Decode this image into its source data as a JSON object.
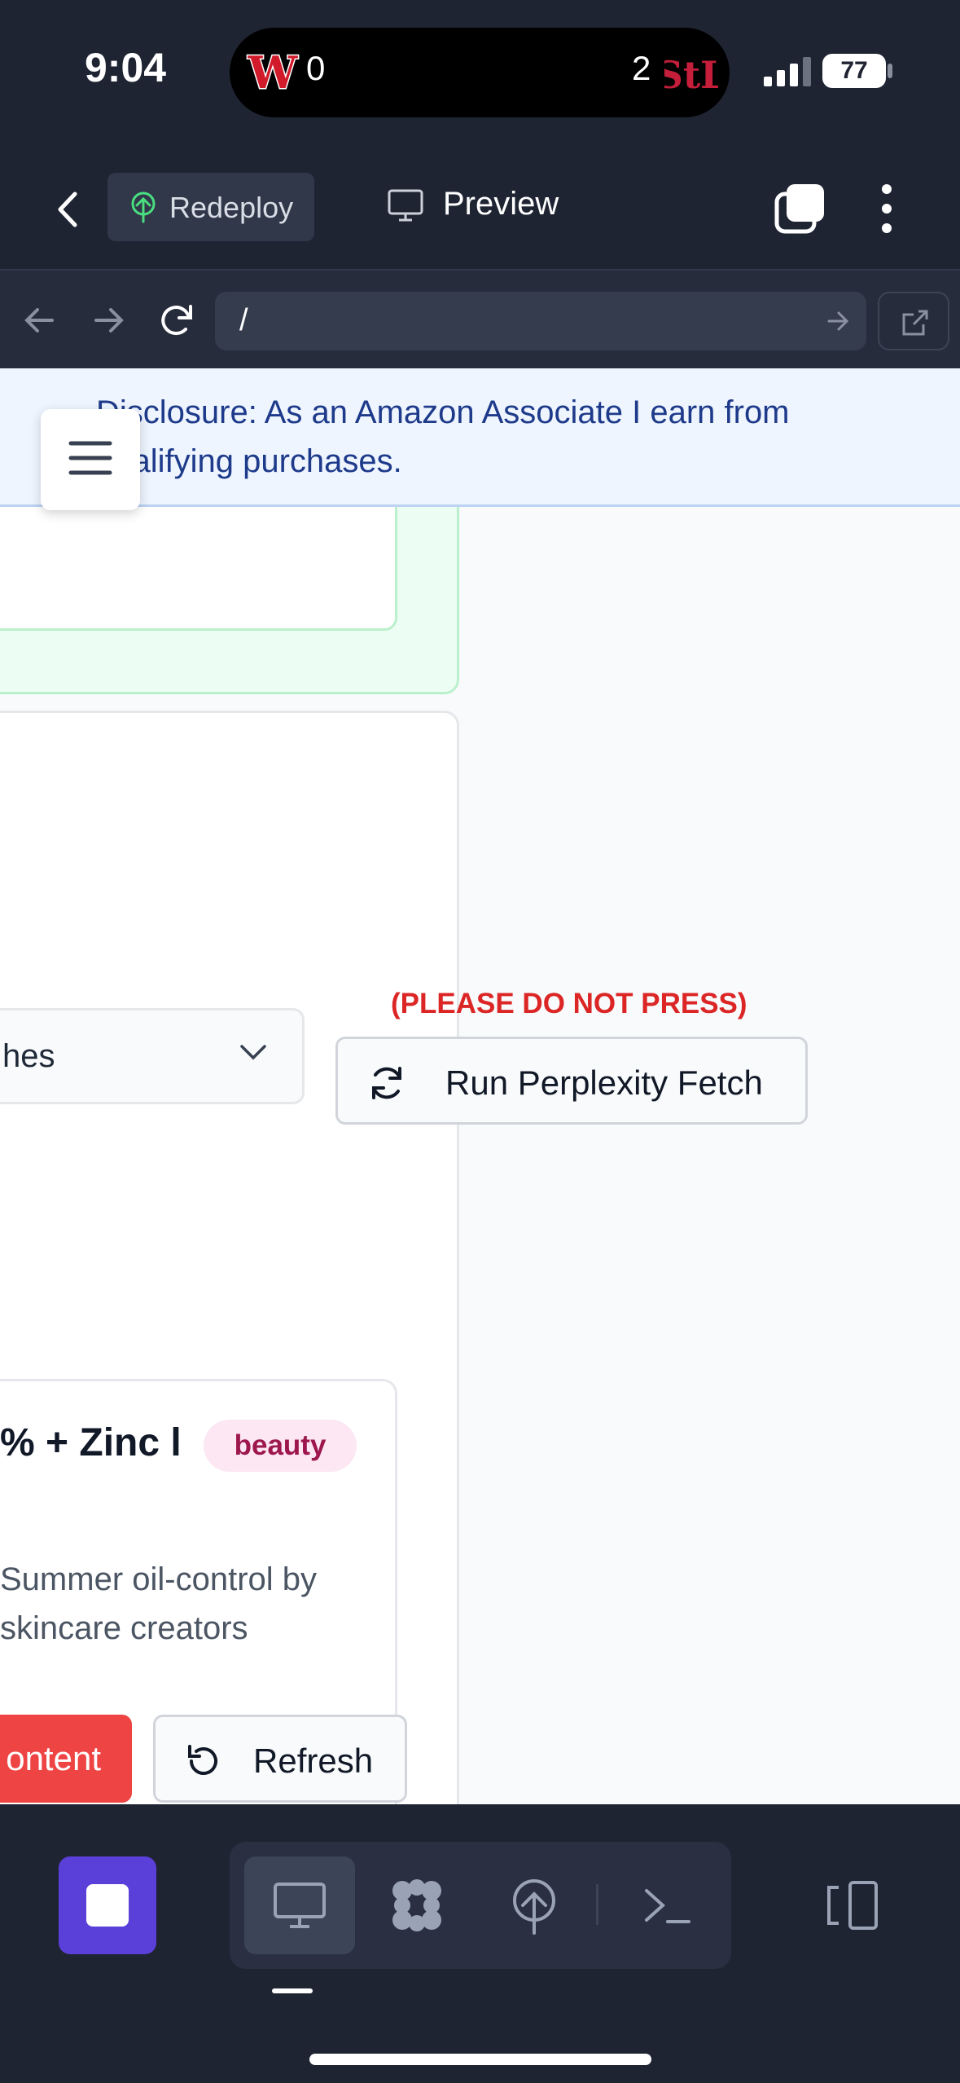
{
  "status_bar": {
    "time": "9:04",
    "away_team": "Washington Nationals",
    "away_score": "0",
    "home_team": "St. Louis Cardinals",
    "home_score": "2",
    "battery": "77"
  },
  "app_bar": {
    "redeploy_label": "Redeploy",
    "preview_label": "Preview"
  },
  "browser": {
    "url": "/"
  },
  "page": {
    "disclosure": "Disclosure: As an Amazon Associate I earn from qualifying purchases.",
    "select_value": "hes",
    "warning": "(PLEASE DO NOT PRESS)",
    "fetch_button": "Run Perplexity Fetch",
    "product": {
      "title": "% + Zinc l",
      "badge": "beauty",
      "description": "Summer oil-control by skincare creators"
    },
    "content_button": "ontent",
    "refresh_button": "Refresh"
  },
  "colors": {
    "accent_purple": "#5b3fd9",
    "warning_red": "#dc2626",
    "badge_bg": "#fce7f3",
    "badge_text": "#9d174d",
    "danger_button": "#ef4444"
  }
}
